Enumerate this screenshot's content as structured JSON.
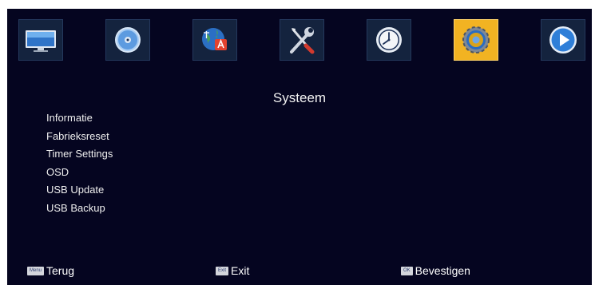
{
  "icons": [
    {
      "name": "tv-icon",
      "active": false
    },
    {
      "name": "disc-icon",
      "active": false
    },
    {
      "name": "language-globe-icon",
      "active": false
    },
    {
      "name": "tools-icon",
      "active": false
    },
    {
      "name": "clock-icon",
      "active": false
    },
    {
      "name": "system-gear-icon",
      "active": true
    },
    {
      "name": "play-icon",
      "active": false
    }
  ],
  "colors": {
    "active_tile": "#f2b322",
    "background": "#050520"
  },
  "page": {
    "title": "Systeem"
  },
  "menu": {
    "items": [
      {
        "label": "Informatie"
      },
      {
        "label": "Fabrieksreset"
      },
      {
        "label": "Timer Settings"
      },
      {
        "label": "OSD"
      },
      {
        "label": "USB Update"
      },
      {
        "label": "USB Backup"
      }
    ]
  },
  "footer": {
    "back": {
      "key": "Menu",
      "label": "Terug"
    },
    "exit": {
      "key": "Exit",
      "label": "Exit"
    },
    "confirm": {
      "key": "OK",
      "label": "Bevestigen"
    }
  }
}
